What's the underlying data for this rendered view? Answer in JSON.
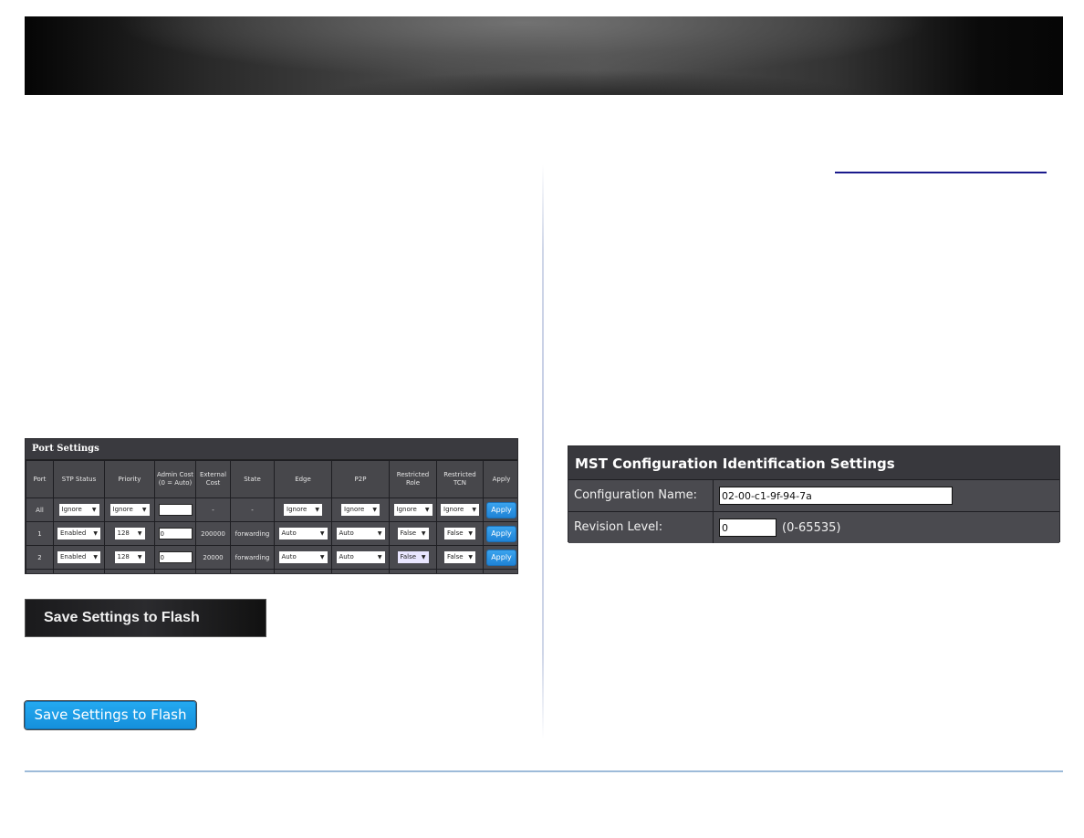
{
  "header": {
    "banner": "decorative-banner"
  },
  "link": {
    "text": ""
  },
  "port_settings": {
    "title": "Port Settings",
    "columns": [
      "Port",
      "STP Status",
      "Priority",
      "Admin Cost (0 = Auto)",
      "External Cost",
      "State",
      "Edge",
      "P2P",
      "Restricted Role",
      "Restricted TCN",
      "Apply"
    ],
    "rows": [
      {
        "port": "All",
        "stp_status": "Ignore",
        "priority": "Ignore",
        "admin_cost": "",
        "external_cost": "-",
        "state": "-",
        "edge": "Ignore",
        "p2p": "Ignore",
        "restricted_role": "Ignore",
        "restricted_tcn": "Ignore",
        "apply": "Apply"
      },
      {
        "port": "1",
        "stp_status": "Enabled",
        "priority": "128",
        "admin_cost": "0",
        "external_cost": "200000",
        "state": "forwarding",
        "edge": "Auto",
        "p2p": "Auto",
        "restricted_role": "False",
        "restricted_tcn": "False",
        "apply": "Apply"
      },
      {
        "port": "2",
        "stp_status": "Enabled",
        "priority": "128",
        "admin_cost": "0",
        "external_cost": "20000",
        "state": "forwarding",
        "edge": "Auto",
        "p2p": "Auto",
        "restricted_role": "False",
        "restricted_tcn": "False",
        "apply": "Apply"
      }
    ]
  },
  "buttons": {
    "save_flash_dark": "Save Settings to Flash",
    "save_flash_blue": "Save Settings to Flash"
  },
  "mst": {
    "title": "MST Configuration Identification Settings",
    "config_name_label": "Configuration Name:",
    "config_name_value": "02-00-c1-9f-94-7a",
    "revision_label": "Revision Level:",
    "revision_value": "0",
    "revision_range": "(0-65535)"
  },
  "icons": {
    "dropdown_arrow": "▼"
  },
  "colors": {
    "apply_blue": "#1f83d6",
    "panel_dark": "#47474b",
    "footer_line": "#9dbbd9",
    "link": "#1a1a8c"
  }
}
